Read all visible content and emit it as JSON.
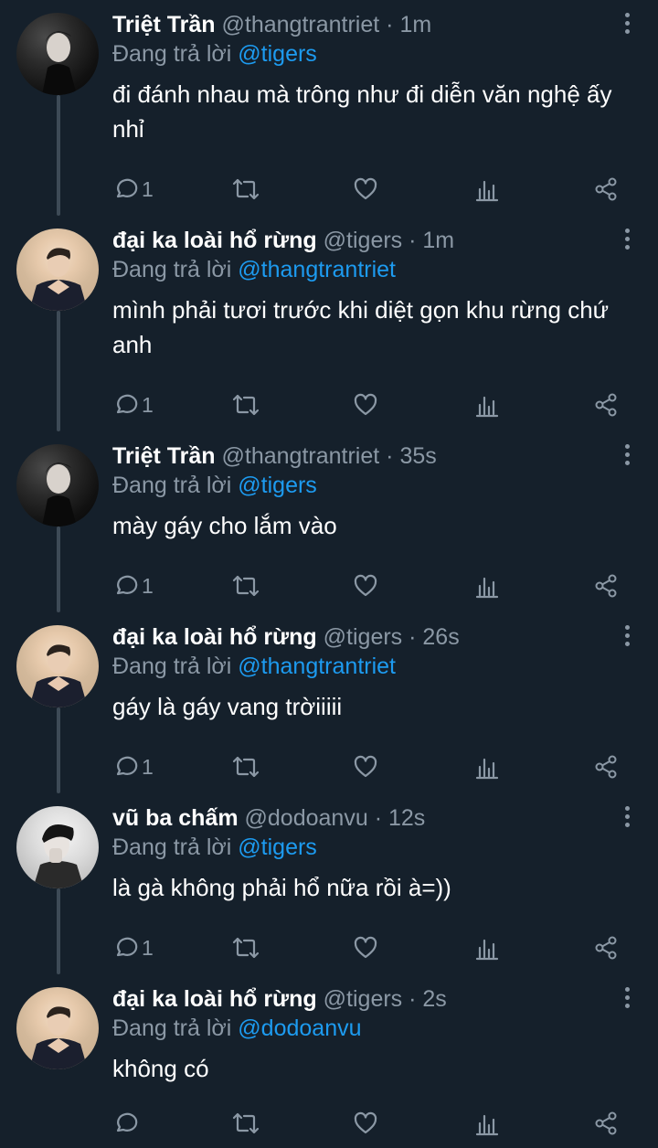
{
  "tweets": [
    {
      "name": "Triệt Trần",
      "handle": "@thangtrantriet",
      "time": "1m",
      "reply_prefix": "Đang trả lời",
      "reply_to": "@tigers",
      "text": "đi đánh nhau mà trông như đi diễn văn nghệ ấy nhỉ",
      "reply_count": "1",
      "avatar": "dark-portrait"
    },
    {
      "name": "đại ka loài hổ rừng",
      "handle": "@tigers",
      "time": "1m",
      "reply_prefix": "Đang trả lời",
      "reply_to": "@thangtrantriet",
      "text": "mình phải tươi trước khi diệt gọn khu rừng chứ anh",
      "reply_count": "1",
      "avatar": "beige-portrait"
    },
    {
      "name": "Triệt Trần",
      "handle": "@thangtrantriet",
      "time": "35s",
      "reply_prefix": "Đang trả lời",
      "reply_to": "@tigers",
      "text": "mày gáy cho lắm vào",
      "reply_count": "1",
      "avatar": "dark-portrait"
    },
    {
      "name": "đại ka loài hổ rừng",
      "handle": "@tigers",
      "time": "26s",
      "reply_prefix": "Đang trả lời",
      "reply_to": "@thangtrantriet",
      "text": "gáy là gáy vang trờiiiii",
      "reply_count": "1",
      "avatar": "beige-portrait"
    },
    {
      "name": "vũ ba chấm",
      "handle": "@dodoanvu",
      "time": "12s",
      "reply_prefix": "Đang trả lời",
      "reply_to": "@tigers",
      "text": "là gà không phải hổ nữa rồi à=))",
      "reply_count": "1",
      "avatar": "light-portrait"
    },
    {
      "name": "đại ka loài hổ rừng",
      "handle": "@tigers",
      "time": "2s",
      "reply_prefix": "Đang trả lời",
      "reply_to": "@dodoanvu",
      "text": "không có",
      "reply_count": "",
      "avatar": "beige-portrait"
    }
  ],
  "separator": "·",
  "icons": [
    "reply-icon",
    "retweet-icon",
    "like-icon",
    "analytics-icon",
    "share-icon",
    "more-icon"
  ],
  "colors": {
    "background": "#15202b",
    "mention": "#1d9bf0",
    "muted": "#8b98a5",
    "thread_line": "#3d4a56"
  }
}
